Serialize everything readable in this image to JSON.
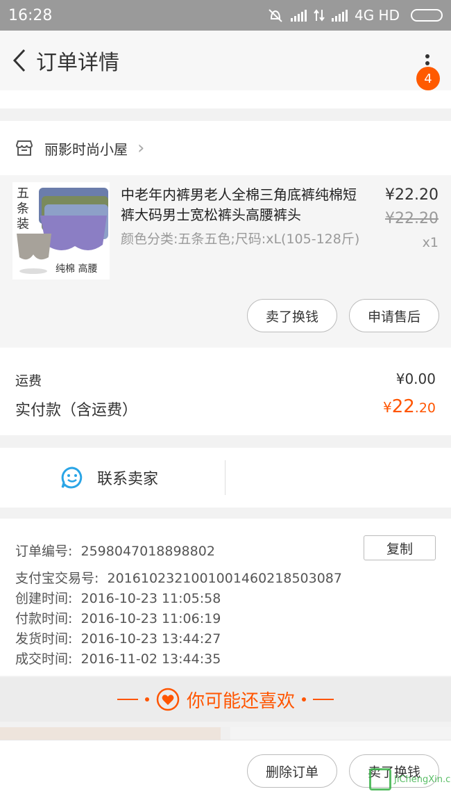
{
  "status_bar": {
    "time": "16:28",
    "network": "4G HD"
  },
  "nav": {
    "title": "订单详情",
    "badge": "4"
  },
  "shop": {
    "name": "丽影时尚小屋"
  },
  "product": {
    "image_text_top": "五条装",
    "image_text_bottom": "纯棉 高腰",
    "title": "中老年内裤男老人全棉三角底裤纯棉短裤大码男士宽松裤头高腰裤头",
    "spec": "颜色分类:五条五色;尺码:xL(105-128斤)",
    "price": "¥22.20",
    "original_price": "¥22.20",
    "quantity": "x1",
    "buttons": [
      "卖了换钱",
      "申请售后"
    ]
  },
  "fees": {
    "shipping_label": "运费",
    "shipping_value": "¥0.00",
    "paid_label": "实付款（含运费）",
    "paid_symbol": "¥",
    "paid_int": "22",
    "paid_dec": ".20"
  },
  "contact": {
    "label": "联系卖家"
  },
  "order_info": {
    "copy_label": "复制",
    "rows": [
      {
        "label": "订单编号:",
        "value": "2598047018898802"
      },
      {
        "label": "支付宝交易号:",
        "value": "2016102321001001460218503087"
      },
      {
        "label": "创建时间:",
        "value": "2016-10-23 11:05:58"
      },
      {
        "label": "付款时间:",
        "value": "2016-10-23 11:06:19"
      },
      {
        "label": "发货时间:",
        "value": "2016-10-23 13:44:27"
      },
      {
        "label": "成交时间:",
        "value": "2016-11-02 13:44:35"
      }
    ]
  },
  "recommend": {
    "label": "你可能还喜欢"
  },
  "bottom_bar": {
    "buttons": [
      "删除订单",
      "卖了换钱"
    ]
  },
  "watermark": {
    "text": "JiChengXin.com"
  },
  "colors": {
    "accent": "#ff5500",
    "contact_icon": "#2aa5e6",
    "badge": "#ff5a00"
  }
}
